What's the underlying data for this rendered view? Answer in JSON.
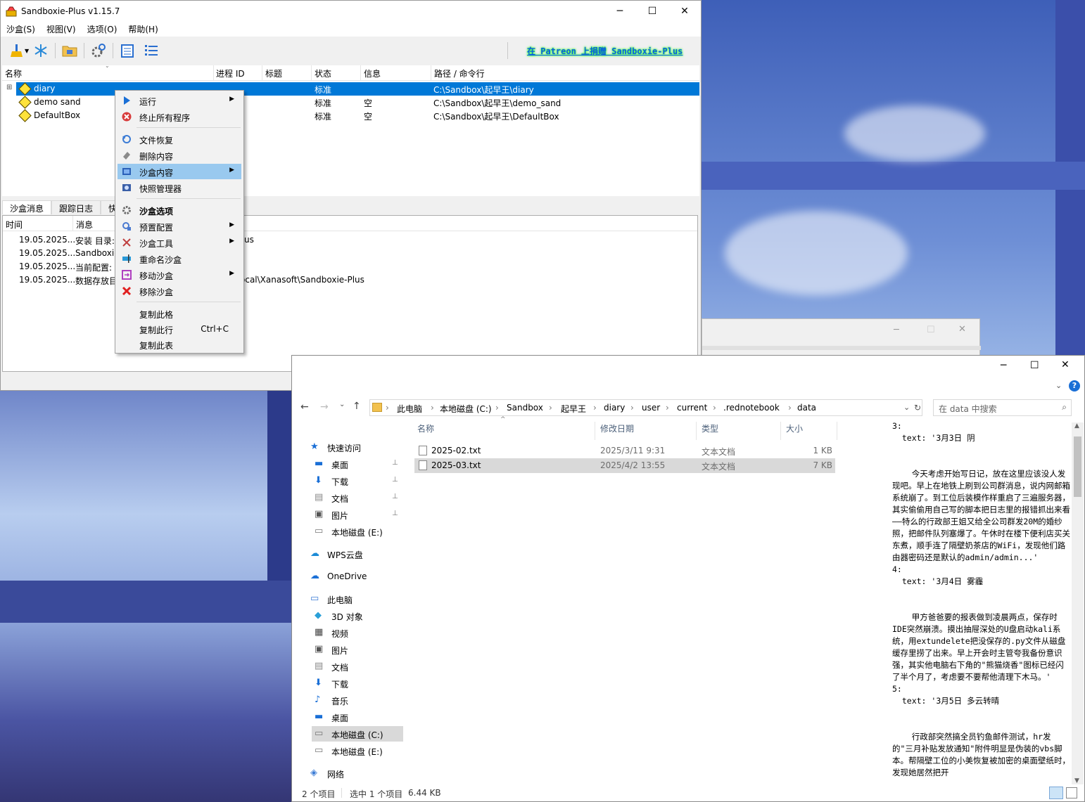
{
  "sandboxie": {
    "title": "Sandboxie-Plus v1.15.7",
    "menu": [
      "沙盒(S)",
      "视图(V)",
      "选项(O)",
      "帮助(H)"
    ],
    "patreon": "在 Patreon 上捐赠 Sandboxie-Plus",
    "columns": [
      "名称",
      "进程 ID",
      "标题",
      "状态",
      "信息",
      "路径 / 命令行"
    ],
    "boxes": [
      {
        "name": "diary",
        "status": "标准",
        "info": "",
        "path": "C:\\Sandbox\\起早王\\diary"
      },
      {
        "name": "demo sand",
        "status": "标准",
        "info": "空",
        "path": "C:\\Sandbox\\起早王\\demo_sand"
      },
      {
        "name": "DefaultBox",
        "status": "标准",
        "info": "空",
        "path": "C:\\Sandbox\\起早王\\DefaultBox"
      }
    ],
    "tabs": [
      "沙盒消息",
      "跟踪日志",
      "快"
    ],
    "log_columns": [
      "时间",
      "消息"
    ],
    "log": [
      {
        "time": "19.05.2025...",
        "msg": "安装 目录: ",
        "tail": "us"
      },
      {
        "time": "19.05.2025...",
        "msg": "Sandboxie",
        "tail": ""
      },
      {
        "time": "19.05.2025...",
        "msg": "当前配置: C",
        "tail": ""
      },
      {
        "time": "19.05.2025...",
        "msg": "数据存放目",
        "tail": "ocal\\Xanasoft\\Sandboxie-Plus"
      }
    ]
  },
  "context_menu": {
    "items": [
      {
        "label": "运行",
        "submenu": true,
        "icon": "play-icon",
        "color": "#1a6fd6"
      },
      {
        "label": "终止所有程序",
        "icon": "stop-icon",
        "color": "#d83b3b"
      },
      {
        "label": "文件恢复",
        "icon": "recover-icon",
        "color": "#3a7bd5"
      },
      {
        "label": "删除内容",
        "icon": "eraser-icon",
        "color": "#7a7a7a"
      },
      {
        "label": "沙盒内容",
        "submenu": true,
        "icon": "box-content-icon",
        "color": "#2a60b8"
      },
      {
        "label": "快照管理器",
        "icon": "snapshot-icon",
        "color": "#3a5fa8"
      },
      {
        "label": "沙盒选项",
        "bold": true,
        "icon": "gear-icon",
        "color": "#6a6a6a"
      },
      {
        "label": "预置配置",
        "submenu": true,
        "icon": "preset-icon",
        "color": "#4a7ad0"
      },
      {
        "label": "沙盒工具",
        "submenu": true,
        "icon": "tools-icon",
        "color": "#c04040"
      },
      {
        "label": "重命名沙盒",
        "icon": "rename-icon",
        "color": "#2a9ad8"
      },
      {
        "label": "移动沙盒",
        "submenu": true,
        "icon": "move-icon",
        "color": "#b040c0"
      },
      {
        "label": "移除沙盒",
        "icon": "remove-icon",
        "color": "#e02020"
      },
      {
        "label": "复制此格",
        "icon": ""
      },
      {
        "label": "复制此行",
        "shortcut": "Ctrl+C",
        "icon": ""
      },
      {
        "label": "复制此表",
        "icon": ""
      }
    ]
  },
  "explorer": {
    "breadcrumb": [
      "此电脑",
      "本地磁盘 (C:)",
      "Sandbox",
      "起早王",
      "diary",
      "user",
      "current",
      ".rednotebook",
      "data"
    ],
    "search_placeholder": "在 data 中搜索",
    "nav": [
      {
        "label": "快速访问",
        "icon": "star-icon"
      },
      {
        "label": "桌面",
        "icon": "desktop-icon",
        "pinned": true
      },
      {
        "label": "下载",
        "icon": "download-icon",
        "pinned": true
      },
      {
        "label": "文档",
        "icon": "document-icon",
        "pinned": true
      },
      {
        "label": "图片",
        "icon": "picture-icon",
        "pinned": true
      },
      {
        "label": "本地磁盘 (E:)",
        "icon": "drive-icon"
      },
      {
        "label": "WPS云盘",
        "icon": "cloud-icon"
      },
      {
        "label": "OneDrive",
        "icon": "onedrive-icon"
      },
      {
        "label": "此电脑",
        "icon": "pc-icon"
      },
      {
        "label": "3D 对象",
        "icon": "cube-icon"
      },
      {
        "label": "视频",
        "icon": "video-icon"
      },
      {
        "label": "图片",
        "icon": "picture-icon"
      },
      {
        "label": "文档",
        "icon": "document-icon"
      },
      {
        "label": "下载",
        "icon": "download-icon"
      },
      {
        "label": "音乐",
        "icon": "music-icon"
      },
      {
        "label": "桌面",
        "icon": "desktop-icon"
      },
      {
        "label": "本地磁盘 (C:)",
        "icon": "drive-icon",
        "selected": true
      },
      {
        "label": "本地磁盘 (E:)",
        "icon": "drive-icon"
      },
      {
        "label": "网络",
        "icon": "network-icon"
      }
    ],
    "columns": [
      "名称",
      "修改日期",
      "类型",
      "大小"
    ],
    "files": [
      {
        "name": "2025-02.txt",
        "date": "2025/3/11 9:31",
        "type": "文本文档",
        "size": "1 KB"
      },
      {
        "name": "2025-03.txt",
        "date": "2025/4/2 13:55",
        "type": "文本文档",
        "size": "7 KB",
        "selected": true
      }
    ],
    "preview": "3:\n  text: '3月3日 阴\n\n\n    今天考虑开始写日记，放在这里应该没人发现吧。早上在地铁上刷到公司群消息，说内网邮箱系统崩了。到工位后装模作样重启了三遍服务器，其实偷偷用自己写的脚本把日志里的报错抓出来看——特么的行政部王姐又给全公司群发20M的婚纱照，把邮件队列塞爆了。午休时在楼下便利店买关东煮，顺手连了隔壁奶茶店的WiFi，发现他们路由器密码还是默认的admin/admin...'\n4:\n  text: '3月4日 雾霾\n\n\n    甲方爸爸要的报表做到凌晨两点，保存时IDE突然崩溃。摸出抽屉深处的U盘启动kali系统，用extundelete把没保存的.py文件从磁盘缓存里捞了出来。早上开会时主管夸我备份意识强，其实他电脑右下角的\"熊猫烧香\"图标已经闪了半个月了，考虑要不要帮他清理下木马。'\n5:\n  text: '3月5日 多云转晴\n\n\n    行政部突然搞全员钓鱼邮件测试，hr发的\"三月补贴发放通知\"附件明显是伪装的vbs脚本。帮隔壁工位的小美恢复被加密的桌面壁纸时，发现她居然把开",
    "status": {
      "count": "2 个项目",
      "selected": "选中 1 个项目",
      "size": "6.44 KB"
    }
  }
}
